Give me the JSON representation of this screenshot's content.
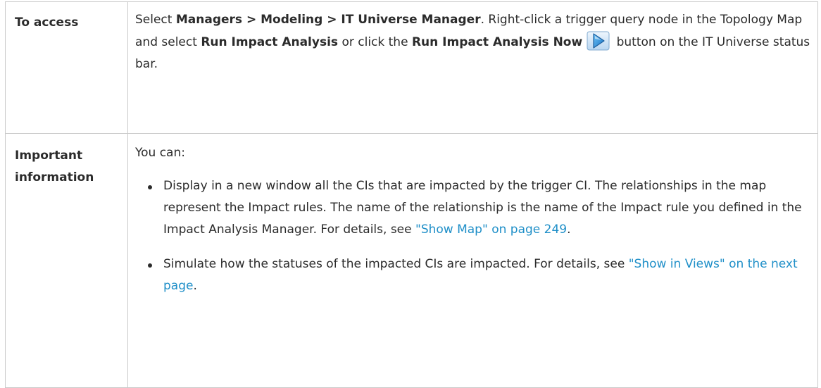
{
  "access": {
    "label": "To access",
    "select": "Select ",
    "path": "Managers > Modeling > IT Universe Manager",
    "after_path": ". Right-click a trigger query node in the Topology Map and select ",
    "menu_item": "Run Impact Analysis",
    "or_click": " or click the ",
    "button_name": "Run Impact Analysis Now",
    "icon": "play-triangle-icon",
    "tail": " button on the IT Universe status bar."
  },
  "important": {
    "label": "Important information",
    "intro": "You can:",
    "items": [
      {
        "text": "Display in a new window all the CIs that are impacted by the trigger CI. The relationships in the map represent the Impact rules. The name of the relationship is the name of the Impact rule you defined in the Impact Analysis Manager. For details, see ",
        "link": "\"Show Map\" on page 249",
        "end": "."
      },
      {
        "text": "Simulate how the statuses of the impacted CIs are impacted. For details, see ",
        "link": "\"Show in Views\" on the next page",
        "end": "."
      }
    ]
  },
  "colors": {
    "link": "#1f8fc8",
    "border": "#c9c9c9",
    "text": "#2b2b2b"
  }
}
